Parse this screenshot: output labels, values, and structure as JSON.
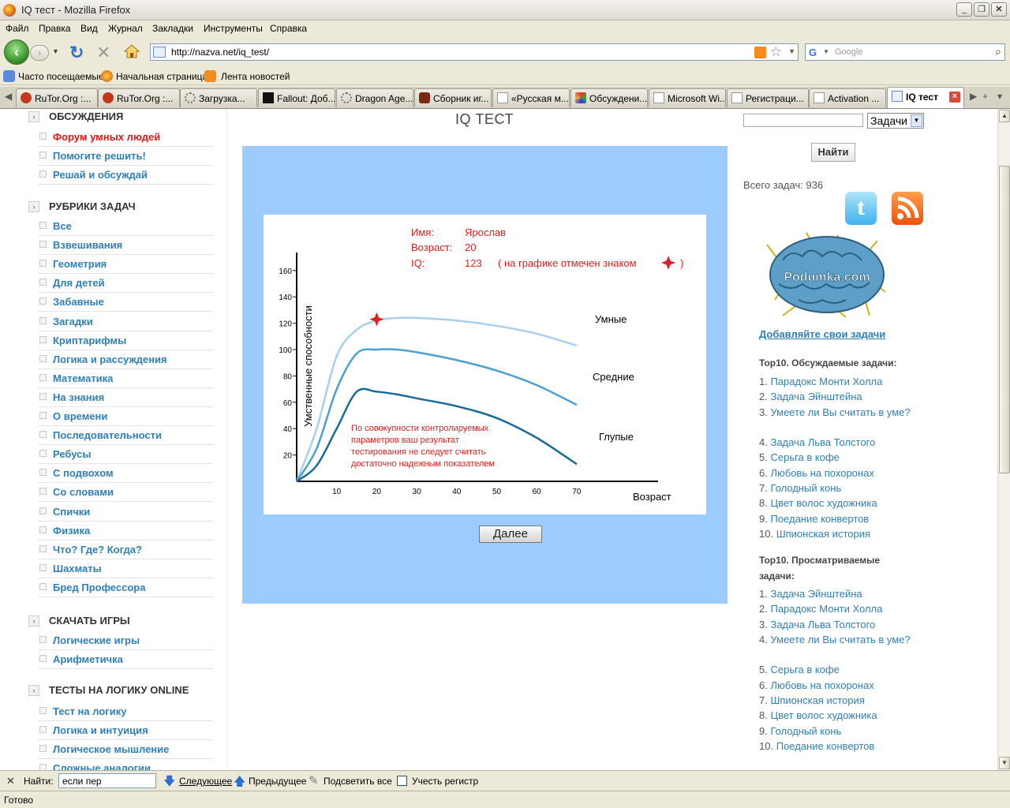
{
  "window": {
    "title": "IQ тест - Mozilla Firefox"
  },
  "menu": [
    "Файл",
    "Правка",
    "Вид",
    "Журнал",
    "Закладки",
    "Инструменты",
    "Справка"
  ],
  "nav": {
    "url": "http://nazva.net/iq_test/",
    "search_placeholder": "Google"
  },
  "bookmarks": [
    "Часто посещаемые",
    "Начальная страница",
    "Лента новостей"
  ],
  "tabs": [
    {
      "label": "RuTor.Org :..."
    },
    {
      "label": "RuTor.Org :..."
    },
    {
      "label": "Загрузка..."
    },
    {
      "label": "Fallout: Доб..."
    },
    {
      "label": "Dragon Age..."
    },
    {
      "label": "Сборник иг..."
    },
    {
      "label": "«Русская м..."
    },
    {
      "label": "Обсуждени..."
    },
    {
      "label": "Microsoft Wi..."
    },
    {
      "label": "Регистраци..."
    },
    {
      "label": "Activation ..."
    },
    {
      "label": "IQ тест"
    }
  ],
  "sidebar": {
    "sections": [
      {
        "title": "ОБСУЖДЕНИЯ",
        "items": [
          "Форум умных людей",
          "Помогите решить!",
          "Решай и обсуждай"
        ]
      },
      {
        "title": "РУБРИКИ ЗАДАЧ",
        "items": [
          "Все",
          "Взвешивания",
          "Геометрия",
          "Для детей",
          "Забавные",
          "Загадки",
          "Криптарифмы",
          "Логика и рассуждения",
          "Математика",
          "На знания",
          "О времени",
          "Последовательности",
          "Ребусы",
          "С подвохом",
          "Со словами",
          "Спички",
          "Физика",
          "Что? Где? Когда?",
          "Шахматы",
          "Бред Профессора"
        ]
      },
      {
        "title": "СКАЧАТЬ ИГРЫ",
        "items": [
          "Логические игры",
          "Арифметичка"
        ]
      },
      {
        "title": "ТЕСТЫ НА ЛОГИКУ ONLINE",
        "items": [
          "Тест на логику",
          "Логика и интуиция",
          "Логическое мышление",
          "Сложные аналогии"
        ]
      }
    ]
  },
  "main": {
    "title": "IQ ТЕСТ",
    "next_button": "Далее",
    "result": {
      "name_label": "Имя:",
      "name": "Ярослав",
      "age_label": "Возраст:",
      "age": "20",
      "iq_label": "IQ:",
      "iq": "123",
      "note": "( на графике отмечен знаком",
      "note_close": ")"
    },
    "disclaimer": [
      "По совокупности контролируемых",
      "параметров ваш результат",
      "тестирования не следует считать",
      "достаточно надежным показателем"
    ]
  },
  "chart_data": {
    "type": "line",
    "xlabel": "Возраст",
    "ylabel": "Умственные способности",
    "x_ticks": [
      10,
      20,
      30,
      40,
      50,
      60,
      70
    ],
    "y_ticks": [
      20,
      40,
      60,
      80,
      100,
      120,
      140,
      160
    ],
    "xlim": [
      0,
      90
    ],
    "ylim": [
      0,
      180
    ],
    "series": [
      {
        "name": "Умные",
        "x": [
          0,
          5,
          10,
          15,
          20,
          25,
          30,
          40,
          50,
          60,
          70
        ],
        "values": [
          0,
          40,
          95,
          115,
          122,
          124,
          124,
          122,
          118,
          112,
          103
        ]
      },
      {
        "name": "Средние",
        "x": [
          0,
          5,
          10,
          15,
          20,
          25,
          30,
          40,
          50,
          60,
          70
        ],
        "values": [
          0,
          25,
          70,
          97,
          100,
          100,
          98,
          92,
          84,
          73,
          58
        ]
      },
      {
        "name": "Глупые",
        "x": [
          0,
          5,
          10,
          15,
          20,
          25,
          30,
          40,
          50,
          60,
          70
        ],
        "values": [
          0,
          12,
          40,
          68,
          68,
          66,
          63,
          57,
          48,
          33,
          13
        ]
      }
    ],
    "marker": {
      "x": 20,
      "y": 123
    }
  },
  "colors": {
    "smart": "#a8d0ee",
    "avg": "#4d9fce",
    "dumb": "#1a6a99",
    "marker": "#e02020",
    "panel": "#9ccbfe",
    "link": "#2f7fb6"
  },
  "right": {
    "select_value": "Задачи",
    "find_button": "Найти",
    "total": "Всего задач: 936",
    "logo_text": "Podumka.com",
    "add_link": "Добавляйте свои задачи",
    "top_discussed_title": "Top10. Обсуждаемые задачи:",
    "top_discussed": [
      "Парадокс Монти Холла",
      "Задача Эйнштейна",
      "Умеете ли Вы считать в уме?",
      "Задача Льва Толстого",
      "Серьга в кофе",
      "Любовь на похоронах",
      "Голодный конь",
      "Цвет волос художника",
      "Поедание конвертов",
      "Шпионская история"
    ],
    "top_viewed_title": "Top10. Просматриваемые задачи:",
    "top_viewed": [
      "Задача Эйнштейна",
      "Парадокс Монти Холла",
      "Задача Льва Толстого",
      "Умеете ли Вы считать в уме?",
      "Серьга в кофе",
      "Любовь на похоронах",
      "Шпионская история",
      "Цвет волос художника",
      "Голодный конь",
      "Поедание конвертов"
    ]
  },
  "findbar": {
    "label": "Найти:",
    "value": "если пер",
    "next": "Следующее",
    "prev": "Предыдущее",
    "highlight": "Подсветить все",
    "match_case": "Учесть регистр"
  },
  "status": "Готово"
}
